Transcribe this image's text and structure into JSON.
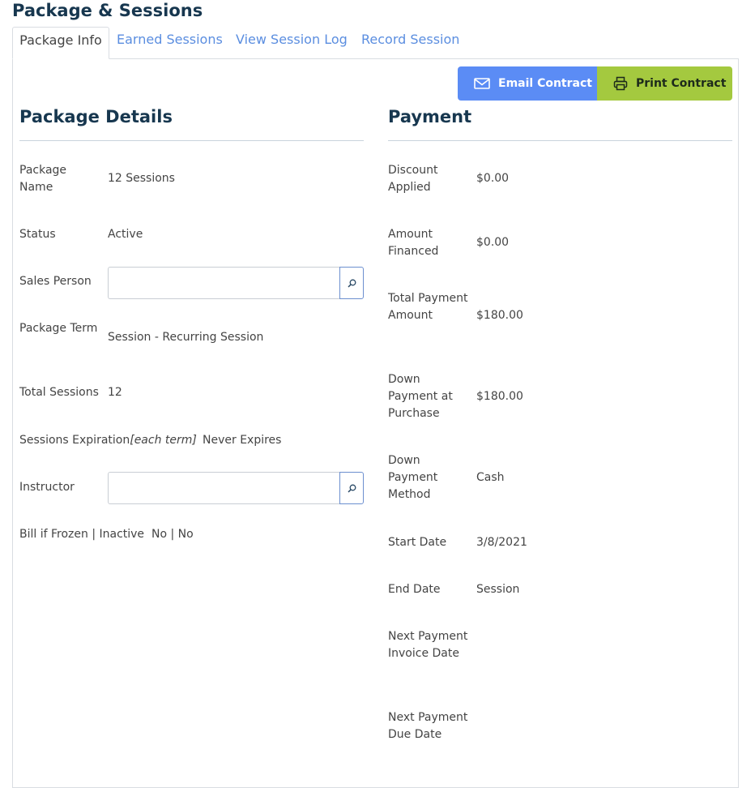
{
  "page_title": "Package & Sessions",
  "tabs": [
    {
      "label": "Package Info"
    },
    {
      "label": "Earned Sessions"
    },
    {
      "label": "View Session Log"
    },
    {
      "label": "Record Session"
    }
  ],
  "actions": {
    "email_label": "Email Contract",
    "print_label": "Print Contract"
  },
  "colors": {
    "title": "#17374f",
    "tab_link": "#5b8ee0",
    "email_button": "#5b8cf5",
    "print_button": "#a4c93f"
  },
  "package_details": {
    "title": "Package Details",
    "package_name": {
      "label": "Package Name",
      "value": "12 Sessions"
    },
    "status": {
      "label": "Status",
      "value": "Active"
    },
    "sales_person": {
      "label": "Sales Person",
      "value": ""
    },
    "package_term": {
      "label": "Package Term",
      "value": "Session - Recurring Session"
    },
    "total_sessions": {
      "label": "Total Sessions",
      "value": "12"
    },
    "sessions_expiration": {
      "label": "Sessions Expiration",
      "note": "[each term]",
      "value": "Never Expires"
    },
    "instructor": {
      "label": "Instructor",
      "value": ""
    },
    "bill_if_frozen": {
      "label": "Bill if Frozen | Inactive",
      "value": "No | No"
    }
  },
  "payment": {
    "title": "Payment",
    "discount_applied": {
      "label": "Discount Applied",
      "value": "$0.00"
    },
    "amount_financed": {
      "label": "Amount Financed",
      "value": "$0.00"
    },
    "total_payment_amount": {
      "label": "Total Payment Amount",
      "value": "$180.00"
    },
    "down_payment_at_purchase": {
      "label": "Down Payment at Purchase",
      "value": "$180.00"
    },
    "down_payment_method": {
      "label": "Down Payment Method",
      "value": "Cash"
    },
    "start_date": {
      "label": "Start Date",
      "value": "3/8/2021"
    },
    "end_date": {
      "label": "End Date",
      "value": "Session"
    },
    "next_payment_invoice_date": {
      "label": "Next Payment Invoice Date",
      "value": ""
    },
    "next_payment_due_date": {
      "label": "Next Payment Due Date",
      "value": ""
    }
  }
}
